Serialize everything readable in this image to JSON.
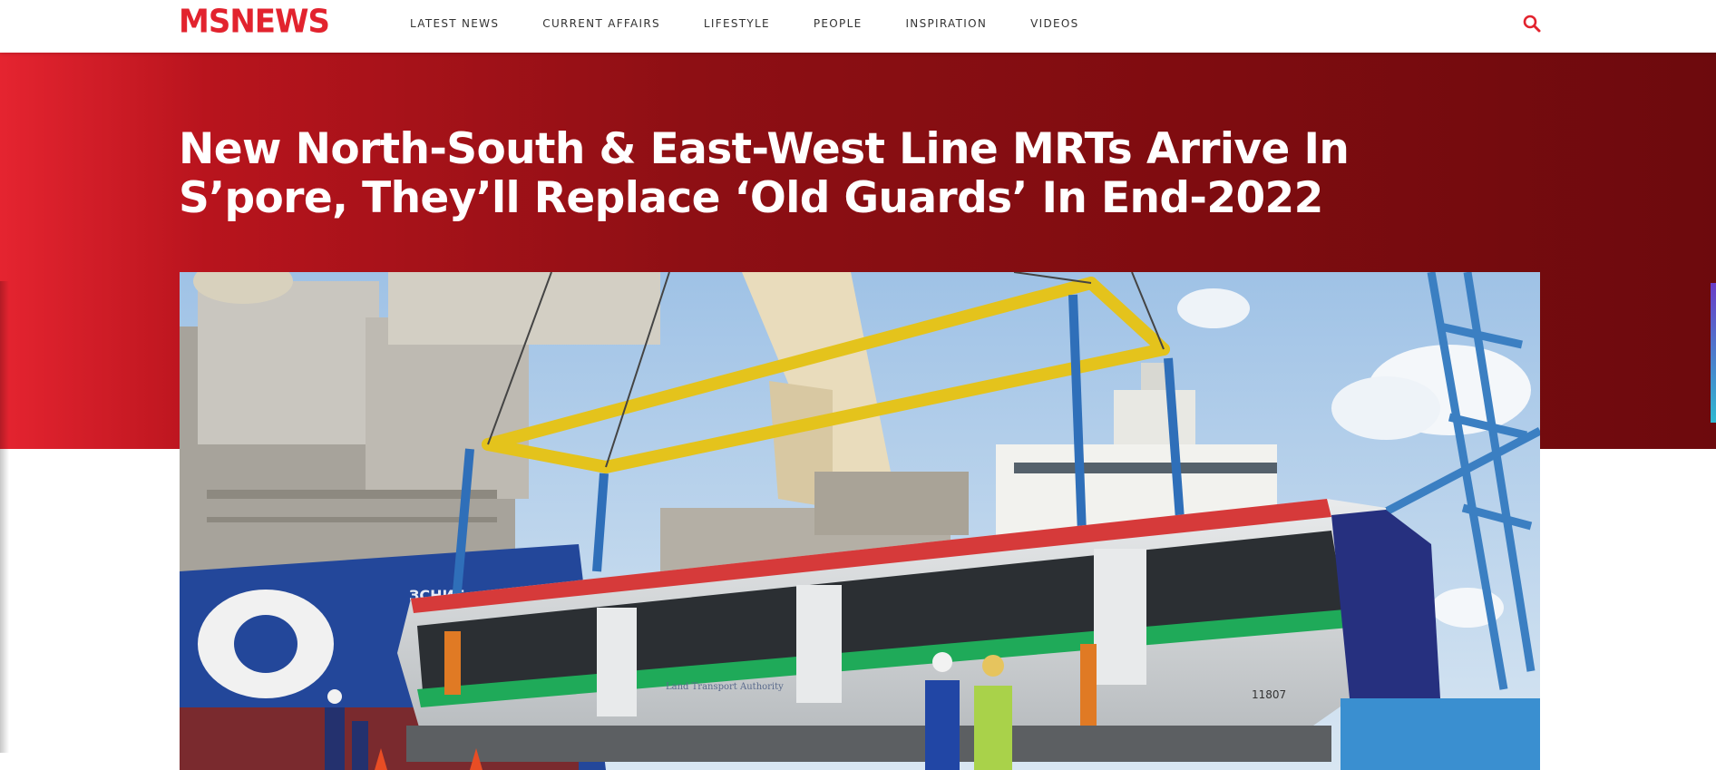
{
  "site": {
    "logo_text": "MSNEWS",
    "brand_color": "#e2232e"
  },
  "nav": {
    "items": [
      {
        "label": "LATEST NEWS"
      },
      {
        "label": "CURRENT AFFAIRS"
      },
      {
        "label": "LIFESTYLE"
      },
      {
        "label": "PEOPLE"
      },
      {
        "label": "INSPIRATION"
      },
      {
        "label": "VIDEOS"
      }
    ],
    "search_icon": "search-icon"
  },
  "article": {
    "title": "New North-South & East-West Line MRTs Arrive In S’pore, They’ll Replace ‘Old Guards’ In End-2022",
    "hero_gradient": [
      "#e52430",
      "#6d0a0d"
    ]
  },
  "photo": {
    "train_number": "11807",
    "train_logo_text": "Land Transport Authority",
    "ship_text": "ЗСНИБ"
  }
}
